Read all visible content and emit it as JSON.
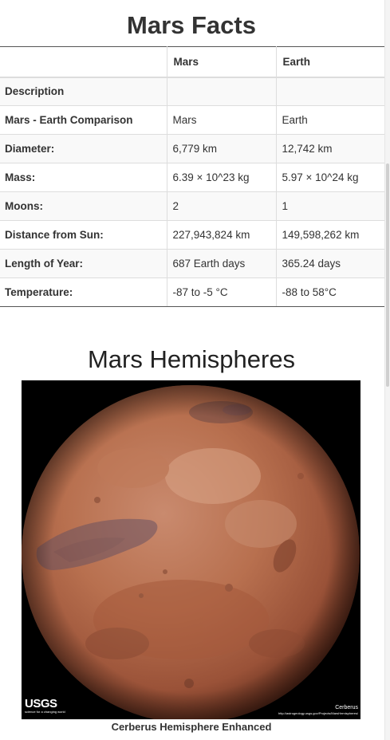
{
  "facts": {
    "title": "Mars Facts",
    "columns": [
      "",
      "Mars",
      "Earth"
    ],
    "rows": [
      [
        "Description",
        "",
        ""
      ],
      [
        "Mars - Earth Comparison",
        "Mars",
        "Earth"
      ],
      [
        "Diameter:",
        "6,779 km",
        "12,742 km"
      ],
      [
        "Mass:",
        "6.39 × 10^23 kg",
        "5.97 × 10^24 kg"
      ],
      [
        "Moons:",
        "2",
        "1"
      ],
      [
        "Distance from Sun:",
        "227,943,824 km",
        "149,598,262 km"
      ],
      [
        "Length of Year:",
        "687 Earth days",
        "365.24 days"
      ],
      [
        "Temperature:",
        "-87 to -5 °C",
        "-88 to 58°C"
      ]
    ]
  },
  "hemispheres": {
    "title": "Mars Hemispheres",
    "image": {
      "logo_text": "USGS",
      "logo_tagline": "science for a changing world",
      "name_mark": "Cerberus",
      "url_mark": "http://astrogeology.usgs.gov/Projects/MarsHemispheres/"
    },
    "caption": "Cerberus Hemisphere Enhanced"
  }
}
